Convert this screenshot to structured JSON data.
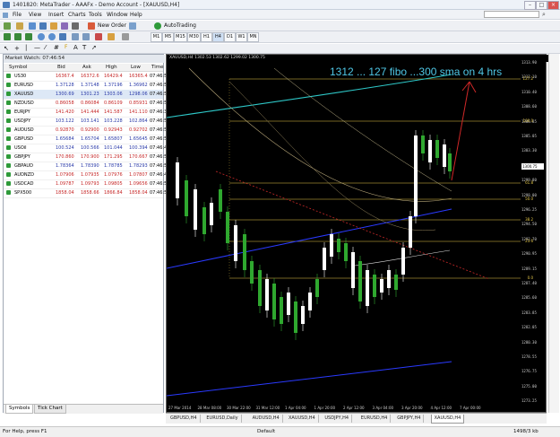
{
  "window": {
    "title": "1401820: MetaTrader - AAAFx - Demo Account - [XAUUSD,H4]"
  },
  "menu": [
    "File",
    "View",
    "Insert",
    "Charts",
    "Tools",
    "Window",
    "Help"
  ],
  "toolbar": {
    "new_order": "New Order",
    "autotrading": "AutoTrading",
    "timeframes": [
      "M1",
      "M5",
      "M15",
      "M30",
      "H1",
      "H4",
      "D1",
      "W1",
      "MN"
    ]
  },
  "market_watch": {
    "title": "Market Watch: 07:46:54",
    "headers": [
      "Symbol",
      "Bid",
      "Ask",
      "High",
      "Low",
      "Time"
    ],
    "rows": [
      [
        "US30",
        "16367.4",
        "16372.6",
        "16429.4",
        "16365.4",
        "07:46:53"
      ],
      [
        "EURUSD",
        "1.37128",
        "1.37148",
        "1.37196",
        "1.36962",
        "07:46:53"
      ],
      [
        "XAUUSD",
        "1300.69",
        "1301.23",
        "1303.06",
        "1298.06",
        "07:46:52"
      ],
      [
        "NZDUSD",
        "0.86058",
        "0.86084",
        "0.86109",
        "0.85931",
        "07:46:52"
      ],
      [
        "EURJPY",
        "141.420",
        "141.444",
        "141.587",
        "141.110",
        "07:46:30"
      ],
      [
        "USDJPY",
        "103.122",
        "103.141",
        "103.228",
        "102.864",
        "07:46:52"
      ],
      [
        "AUDUSD",
        "0.92870",
        "0.92900",
        "0.92943",
        "0.92702",
        "07:46:54"
      ],
      [
        "GBPUSD",
        "1.65684",
        "1.65704",
        "1.65807",
        "1.65645",
        "07:46:53"
      ],
      [
        "USOil",
        "100.524",
        "100.566",
        "101.044",
        "100.394",
        "07:46:41"
      ],
      [
        "GBPJPY",
        "170.860",
        "170.900",
        "171.295",
        "170.667",
        "07:46:54"
      ],
      [
        "GBPAUD",
        "1.78364",
        "1.78390",
        "1.78785",
        "1.78293",
        "07:46:54"
      ],
      [
        "AUDNZD",
        "1.07906",
        "1.07935",
        "1.07976",
        "1.07807",
        "07:46:41"
      ],
      [
        "USDCAD",
        "1.09787",
        "1.09793",
        "1.09805",
        "1.09656",
        "07:46:53"
      ],
      [
        "SPX500",
        "1858.04",
        "1858.66",
        "1866.84",
        "1858.04",
        "07:46:53"
      ]
    ],
    "tabs": [
      "Symbols",
      "Tick Chart"
    ]
  },
  "chart": {
    "header": "XAUUSD,H4  1302.53 1302.62 1299.02 1300.75",
    "annotation": "1312 ... 127 fibo ...300 sma on 4 hrs",
    "price_labels": [
      "1313.90",
      "1312.10",
      "1310.40",
      "1308.60",
      "1306.85",
      "1305.05",
      "1303.30",
      "1301.50",
      "1299.80",
      "1298.00",
      "1296.25",
      "1294.50",
      "1292.70",
      "1290.95",
      "1289.15",
      "1287.40",
      "1285.60",
      "1283.85",
      "1282.05",
      "1280.30",
      "1278.55",
      "1276.75",
      "1275.00",
      "1273.25"
    ],
    "current_price": "1300.75",
    "fibo_labels": [
      "127.2",
      "100.0",
      "61.8",
      "50.0",
      "38.2",
      "23.6",
      "0.0"
    ],
    "date_labels": [
      "27 Mar 2014",
      "28 Mar 08:00",
      "30 Mar 22:00",
      "31 Mar 12:00",
      "1 Apr 04:00",
      "1 Apr 20:00",
      "2 Apr 12:00",
      "3 Apr 04:00",
      "3 Apr 20:00",
      "4 Apr 12:00",
      "7 Apr 00:00"
    ],
    "colors": {
      "background": "#000000",
      "bull": "#ffffff",
      "bear": "#2fa82f",
      "fibo": "#e6c94a",
      "sma300": "#2ec7c7",
      "trend": "#2a3aff",
      "annotation": "#4fc7e6"
    }
  },
  "chart_tabs": [
    "GBPUSD,H4",
    "EURUSD,Daily",
    "AUDUSD,H4",
    "XAUUSD,H4",
    "USDJPY,H4",
    "EURUSD,H4",
    "GBPJPY,H4",
    "XAUUSD,H4"
  ],
  "status": {
    "help": "For Help, press F1",
    "profile": "Default",
    "traffic": "1498/3 kb"
  }
}
